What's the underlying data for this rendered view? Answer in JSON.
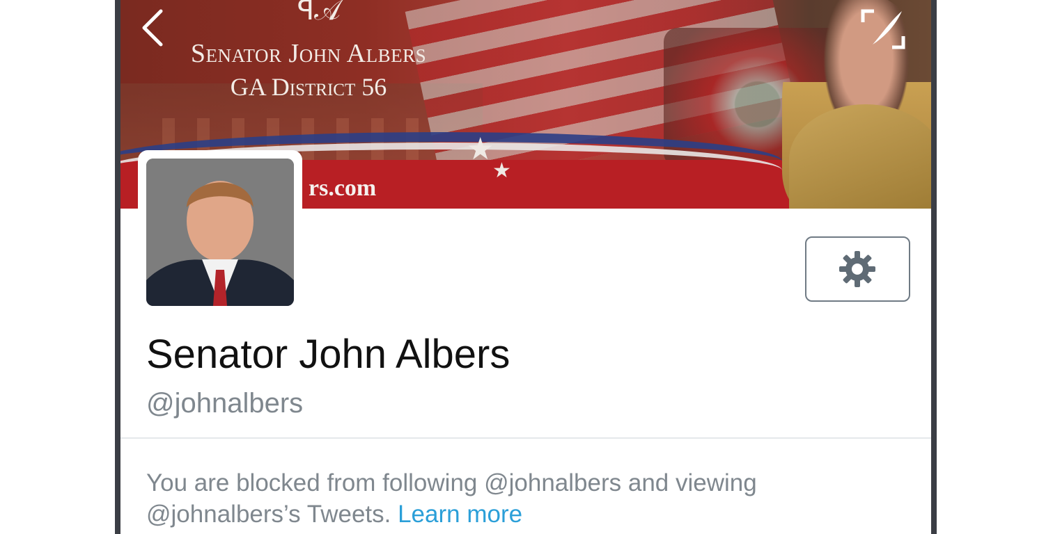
{
  "banner": {
    "title": "Senator John Albers",
    "subtitle": "GA District 56",
    "url_fragment": "rs.com"
  },
  "navigation": {
    "back_icon": "chevron-left-icon",
    "expand_icon": "expand-frame-feather-icon"
  },
  "profile": {
    "display_name": "Senator John Albers",
    "handle": "@johnalbers",
    "settings_icon": "gear-icon"
  },
  "notice": {
    "text": "You are blocked from following @johnalbers and viewing @johnalbers’s Tweets. ",
    "link_label": "Learn more"
  },
  "colors": {
    "link": "#2b9fd8",
    "secondary_text": "#7f878e",
    "primary_text": "#111111"
  }
}
